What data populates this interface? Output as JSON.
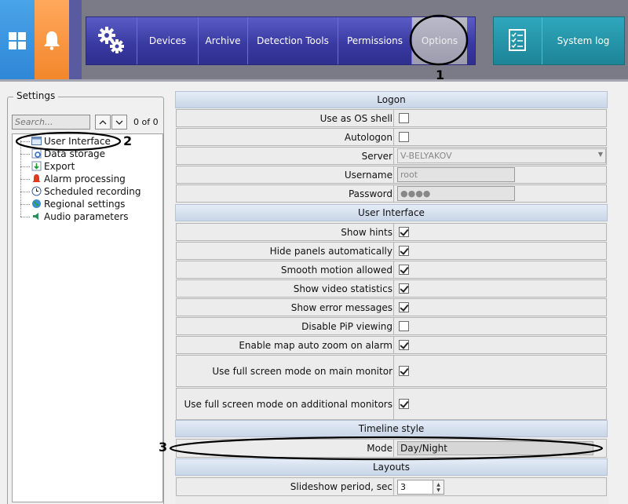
{
  "topbar": {
    "nav": {
      "devices": "Devices",
      "archive": "Archive",
      "detection_tools": "Detection Tools",
      "permissions": "Permissions",
      "options": "Options"
    },
    "system_log": "System log",
    "colors": {
      "main_nav": "#3838a0",
      "system_log": "#1d8496",
      "windows_tile": "#2e86d6",
      "alarm_tile": "#f2862a"
    }
  },
  "callouts": {
    "one": "1",
    "two": "2",
    "three": "3"
  },
  "settings": {
    "title": "Settings",
    "search_placeholder": "Search...",
    "counter": "0 of 0",
    "tree": [
      {
        "label": "User Interface",
        "icon": "window-icon"
      },
      {
        "label": "Data storage",
        "icon": "database-icon"
      },
      {
        "label": "Export",
        "icon": "export-icon"
      },
      {
        "label": "Alarm processing",
        "icon": "alarm-icon"
      },
      {
        "label": "Scheduled recording",
        "icon": "clock-icon"
      },
      {
        "label": "Regional settings",
        "icon": "globe-icon"
      },
      {
        "label": "Audio parameters",
        "icon": "speaker-icon"
      }
    ]
  },
  "form": {
    "logon": {
      "title": "Logon",
      "use_as_os_shell": {
        "label": "Use as OS shell",
        "checked": false
      },
      "autologon": {
        "label": "Autologon",
        "checked": false
      },
      "server": {
        "label": "Server",
        "value": "V-BELYAKOV"
      },
      "username": {
        "label": "Username",
        "value": "root"
      },
      "password": {
        "label": "Password",
        "value": "●●●●"
      }
    },
    "user_interface": {
      "title": "User Interface",
      "rows": [
        {
          "label": "Show hints",
          "checked": true
        },
        {
          "label": "Hide panels automatically",
          "checked": true
        },
        {
          "label": "Smooth motion allowed",
          "checked": true
        },
        {
          "label": "Show video statistics",
          "checked": true
        },
        {
          "label": "Show error messages",
          "checked": true
        },
        {
          "label": "Disable PiP viewing",
          "checked": false
        },
        {
          "label": "Enable map auto zoom on alarm",
          "checked": true
        },
        {
          "label": "Use full screen mode on main monitor",
          "checked": true
        },
        {
          "label": "Use full screen mode on additional monitors",
          "checked": true
        }
      ]
    },
    "timeline_style": {
      "title": "Timeline style",
      "mode": {
        "label": "Mode",
        "value": "Day/Night"
      }
    },
    "layouts": {
      "title": "Layouts",
      "slideshow": {
        "label": "Slideshow period, sec",
        "value": "3"
      }
    }
  }
}
